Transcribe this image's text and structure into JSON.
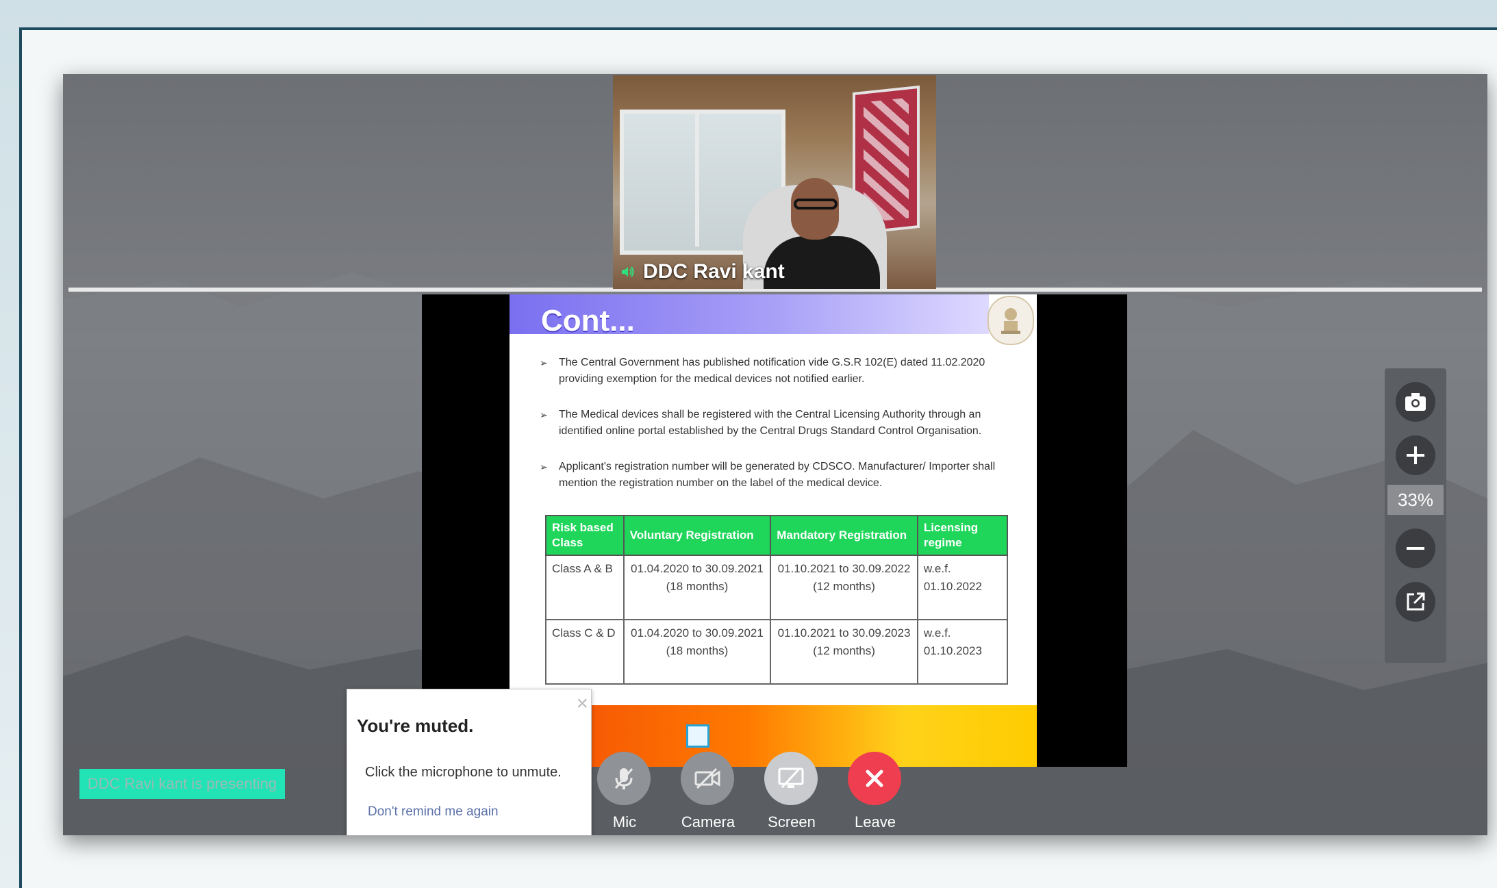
{
  "presenter": {
    "name": "DDC Ravi kant",
    "presenting_text": "DDC Ravi kant is presenting"
  },
  "slide": {
    "title": "Cont...",
    "bullets": [
      "The Central Government has published notification vide G.S.R 102(E) dated 11.02.2020 providing exemption for the medical devices not notified earlier.",
      "The Medical devices shall be registered with the Central Licensing Authority through an identified online portal established by the Central Drugs Standard Control Organisation.",
      "Applicant's registration number will be generated by CDSCO. Manufacturer/ Importer shall mention the registration number on the label of the medical device."
    ],
    "table": {
      "headers": [
        "Risk based Class",
        "Voluntary Registration",
        "Mandatory Registration",
        "Licensing regime"
      ],
      "rows": [
        [
          "Class A & B",
          "01.04.2020 to 30.09.2021 (18 months)",
          "01.10.2021 to 30.09.2022 (12 months)",
          "w.e.f. 01.10.2022"
        ],
        [
          "Class C & D",
          "01.04.2020 to 30.09.2021 (18 months)",
          "01.10.2021 to 30.09.2023 (12 months)",
          "w.e.f. 01.10.2023"
        ]
      ]
    }
  },
  "zoom": {
    "level": "33%",
    "icons": [
      "camera-icon",
      "plus-icon",
      "minus-icon",
      "popout-icon"
    ]
  },
  "muted_popup": {
    "title": "You're muted.",
    "message": "Click the microphone to unmute.",
    "link": "Don't remind me again",
    "close": "×"
  },
  "controls": {
    "mic": "Mic",
    "camera": "Camera",
    "screen": "Screen",
    "leave": "Leave"
  },
  "colors": {
    "accent_green": "#1fd65a",
    "presenting_bg": "#21e3b5",
    "leave_red": "#ee3e4f",
    "slide_header": "#7a6ff0"
  }
}
